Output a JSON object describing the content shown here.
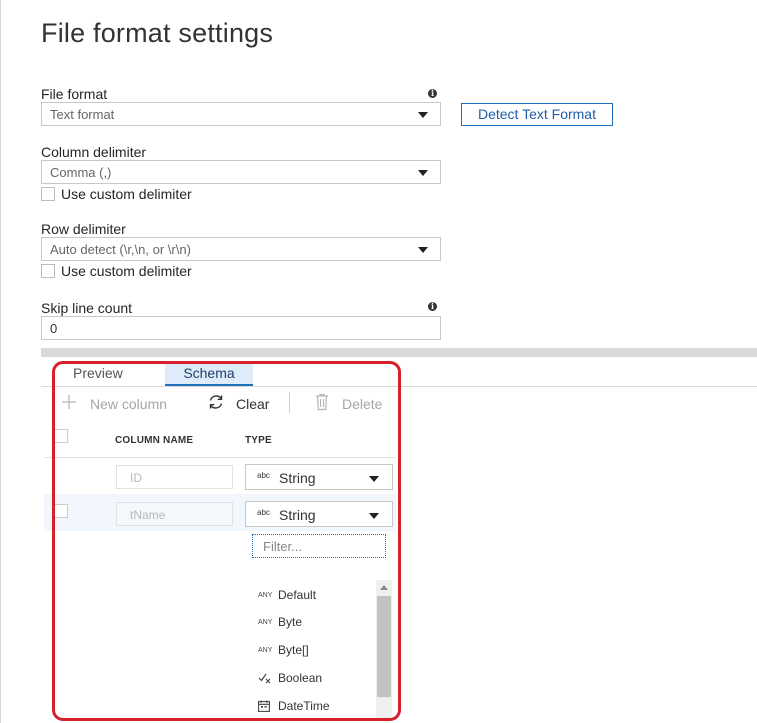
{
  "page": {
    "title": "File format settings"
  },
  "file_format": {
    "label": "File format",
    "value": "Text format",
    "detect_button": "Detect Text Format"
  },
  "column_delimiter": {
    "label": "Column delimiter",
    "value": "Comma (,)",
    "custom_label": "Use custom delimiter"
  },
  "row_delimiter": {
    "label": "Row delimiter",
    "value": "Auto detect (\\r,\\n, or \\r\\n)",
    "custom_label": "Use custom delimiter"
  },
  "skip_line_count": {
    "label": "Skip line count",
    "value": "0"
  },
  "tabs": [
    {
      "label": "Preview",
      "active": false
    },
    {
      "label": "Schema",
      "active": true
    }
  ],
  "toolbar": {
    "new_column": "New column",
    "clear": "Clear",
    "delete": "Delete"
  },
  "schema_table": {
    "headers": [
      "COLUMN NAME",
      "TYPE"
    ],
    "rows": [
      {
        "name_placeholder": "ID",
        "type_icon": "abc",
        "type": "String"
      },
      {
        "name_placeholder": "tName",
        "type_icon": "abc",
        "type": "String"
      }
    ]
  },
  "type_dropdown": {
    "filter_placeholder": "Filter...",
    "options": [
      {
        "icon": "ANY",
        "label": "Default"
      },
      {
        "icon": "ANY",
        "label": "Byte"
      },
      {
        "icon": "ANY",
        "label": "Byte[]"
      },
      {
        "icon": "boolean-icon",
        "label": "Boolean"
      },
      {
        "icon": "calendar-icon",
        "label": "DateTime"
      }
    ]
  },
  "colors": {
    "accent": "#1f6fba",
    "highlight_border": "#d6212b",
    "active_tab_bg": "#deecf9"
  }
}
